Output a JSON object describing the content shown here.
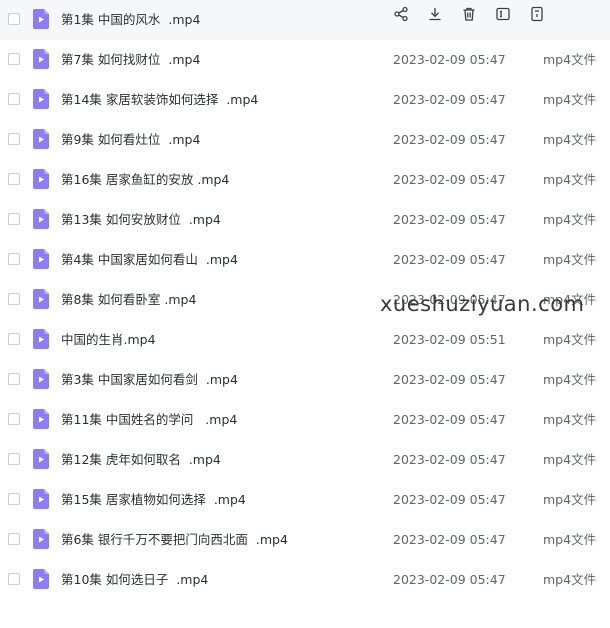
{
  "colors": {
    "accent": "#2f8ef7",
    "file_icon": "#8d7cf6",
    "selected_row_bg": "#f5f7fb"
  },
  "toolbar": {
    "share_icon": "share-icon",
    "download_icon": "download-icon",
    "delete_icon": "trash-icon",
    "rename_icon": "rename-icon",
    "more_icon": "details-icon"
  },
  "files": [
    {
      "name": "第1集 中国的风水  .mp4",
      "date": "",
      "type": ""
    },
    {
      "name": "第7集 如何找财位  .mp4",
      "date": "2023-02-09 05:47",
      "type": "mp4文件"
    },
    {
      "name": "第14集 家居软装饰如何选择  .mp4",
      "date": "2023-02-09 05:47",
      "type": "mp4文件"
    },
    {
      "name": "第9集 如何看灶位  .mp4",
      "date": "2023-02-09 05:47",
      "type": "mp4文件"
    },
    {
      "name": "第16集 居家鱼缸的安放 .mp4",
      "date": "2023-02-09 05:47",
      "type": "mp4文件"
    },
    {
      "name": "第13集 如何安放财位  .mp4",
      "date": "2023-02-09 05:47",
      "type": "mp4文件"
    },
    {
      "name": "第4集 中国家居如何看山  .mp4",
      "date": "2023-02-09 05:47",
      "type": "mp4文件"
    },
    {
      "name": "第8集 如何看卧室 .mp4",
      "date": "2023-02-09 05:47",
      "type": "mp4文件"
    },
    {
      "name": "中国的生肖.mp4",
      "date": "2023-02-09 05:51",
      "type": "mp4文件"
    },
    {
      "name": "第3集 中国家居如何看剑  .mp4",
      "date": "2023-02-09 05:47",
      "type": "mp4文件"
    },
    {
      "name": "第11集 中国姓名的学问   .mp4",
      "date": "2023-02-09 05:47",
      "type": "mp4文件"
    },
    {
      "name": "第12集 虎年如何取名  .mp4",
      "date": "2023-02-09 05:47",
      "type": "mp4文件"
    },
    {
      "name": "第15集 居家植物如何选择  .mp4",
      "date": "2023-02-09 05:47",
      "type": "mp4文件"
    },
    {
      "name": "第6集 银行千万不要把门向西北面  .mp4",
      "date": "2023-02-09 05:47",
      "type": "mp4文件"
    },
    {
      "name": "第10集 如何选日子  .mp4",
      "date": "2023-02-09 05:47",
      "type": "mp4文件"
    }
  ],
  "watermark": "xueshuziyuan.com"
}
